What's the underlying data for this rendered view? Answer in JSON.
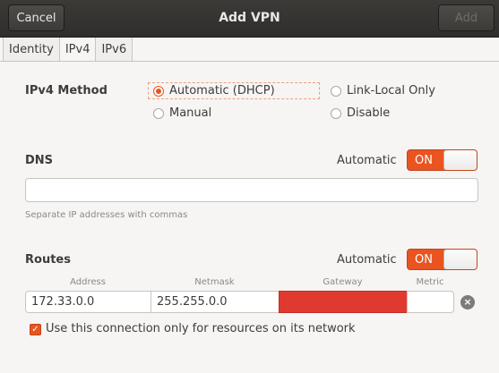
{
  "header": {
    "cancel_label": "Cancel",
    "title": "Add VPN",
    "add_label": "Add"
  },
  "tabs": [
    {
      "label": "Identity",
      "active": false
    },
    {
      "label": "IPv4",
      "active": true
    },
    {
      "label": "IPv6",
      "active": false
    }
  ],
  "ipv4_method": {
    "label": "IPv4 Method",
    "options": [
      {
        "label": "Automatic (DHCP)",
        "selected": true
      },
      {
        "label": "Link-Local Only",
        "selected": false
      },
      {
        "label": "Manual",
        "selected": false
      },
      {
        "label": "Disable",
        "selected": false
      }
    ]
  },
  "dns": {
    "label": "DNS",
    "automatic_label": "Automatic",
    "switch_state": "ON",
    "value": "",
    "hint": "Separate IP addresses with commas"
  },
  "routes": {
    "label": "Routes",
    "automatic_label": "Automatic",
    "switch_state": "ON",
    "columns": [
      "Address",
      "Netmask",
      "Gateway",
      "Metric"
    ],
    "row": {
      "address": "172.33.0.0",
      "netmask": "255.255.0.0",
      "gateway": "",
      "metric": ""
    },
    "gateway_invalid": true
  },
  "only_resources": {
    "label": "Use this connection only for resources on its network",
    "checked": true
  },
  "colors": {
    "accent": "#e95420",
    "error": "#e03a30",
    "headerbar": "#2f2e2c"
  }
}
